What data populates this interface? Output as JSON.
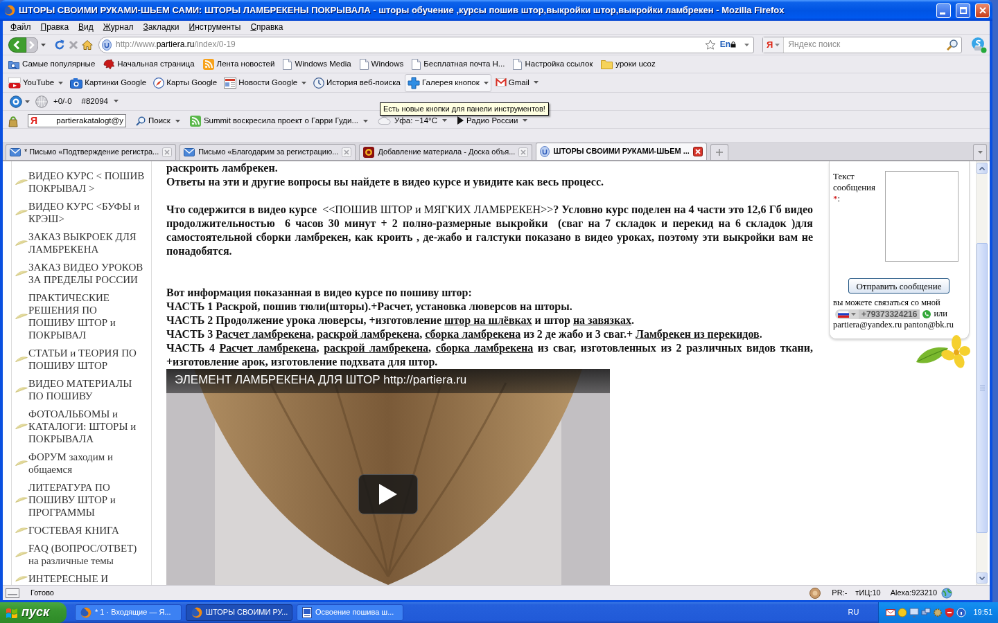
{
  "window": {
    "title": "ШТОРЫ СВОИМИ РУКАМИ-ШЬЕМ САМИ: ШТОРЫ ЛАМБРЕКЕНЫ ПОКРЫВАЛА - шторы обучение ,курсы пошив штор,выкройки штор,выкройки ламбрекен - Mozilla Firefox"
  },
  "menu": [
    "Файл",
    "Правка",
    "Вид",
    "Журнал",
    "Закладки",
    "Инструменты",
    "Справка"
  ],
  "navigation": {
    "address": [
      {
        "text": "http://www.",
        "strong": false
      },
      {
        "text": "partiera.ru",
        "strong": true
      },
      {
        "text": "/index/0-19",
        "strong": false
      }
    ],
    "language": "En",
    "search_engine": "Я",
    "search": {
      "placeholder": "Яндекс поиск"
    }
  },
  "bookmarks": [
    {
      "label": "Самые популярные",
      "kind": "query"
    },
    {
      "label": "Начальная страница",
      "kind": "homepage"
    },
    {
      "label": "Лента новостей",
      "kind": "livemark"
    },
    {
      "label": "Windows Media",
      "kind": "page"
    },
    {
      "label": "Windows",
      "kind": "page"
    },
    {
      "label": "Бесплатная почта Н...",
      "kind": "page"
    },
    {
      "label": "Настройка ссылок",
      "kind": "page"
    },
    {
      "label": "уроки ucoz",
      "kind": "folder"
    }
  ],
  "google_toolbar": [
    {
      "label": "YouTube",
      "kind": "video",
      "has_menu": true,
      "highlighted": false
    },
    {
      "label": "Картинки Google",
      "kind": "images",
      "has_menu": false,
      "highlighted": false
    },
    {
      "label": "Карты Google",
      "kind": "maps",
      "has_menu": false,
      "highlighted": false
    },
    {
      "label": "Новости Google",
      "kind": "news",
      "has_menu": true,
      "highlighted": false
    },
    {
      "label": "История веб-поиска",
      "kind": "history",
      "has_menu": false,
      "highlighted": false
    },
    {
      "label": "Галерея кнопок",
      "kind": "gallery",
      "has_menu": true,
      "highlighted": true
    },
    {
      "label": "Gmail",
      "kind": "mail",
      "has_menu": true,
      "highlighted": false
    }
  ],
  "counter_toolbar": {
    "score": "+0/-0",
    "counter": "#82094"
  },
  "tooltip": {
    "text": "Есть новые кнопки для панели инструментов!"
  },
  "yandex_toolbar": {
    "logo_letter": "Я",
    "login": "partierakatalogt@y",
    "search": "Поиск",
    "news": "Summit воскресила проект о Гарри Гуди...",
    "weather": "Уфа: −14°C",
    "radio": "Радио России"
  },
  "tabs": [
    {
      "label": "* Письмо «Подтверждение регистра...",
      "kind": "mail",
      "selected": false
    },
    {
      "label": "Письмо «Благодарим за регистрацию...",
      "kind": "mail",
      "selected": false
    },
    {
      "label": "Добавление материала - Доска объя...",
      "kind": "board",
      "selected": false
    },
    {
      "label": "ШТОРЫ СВОИМИ РУКАМИ-ШЬЕМ ...",
      "kind": "site",
      "selected": true
    }
  ],
  "sidebar": {
    "items": [
      "ВИДЕО КУРС < ПОШИВ ПОКРЫВАЛ >",
      "ВИДЕО КУРС <БУФЫ и КРЭШ>",
      "ЗАКАЗ ВЫКРОЕК ДЛЯ ЛАМБРЕКЕНА",
      "ЗАКАЗ ВИДЕО УРОКОВ ЗА ПРЕДЕЛЫ РОССИИ",
      "ПРАКТИЧЕСКИЕ РЕШЕНИЯ ПО ПОШИВУ ШТОР и ПОКРЫВАЛ",
      "СТАТЬИ и ТЕОРИЯ ПО ПОШИВУ ШТОР",
      "ВИДЕО МАТЕРИАЛЫ ПО ПОШИВУ",
      "ФОТОАЛЬБОМЫ и КАТАЛОГИ: ШТОРЫ и ПОКРЫВАЛА",
      "ФОРУМ заходим и общаемся",
      "ЛИТЕРАТУРА ПО ПОШИВУ ШТОР и ПРОГРАММЫ",
      "ГОСТЕВАЯ КНИГА",
      "FAQ (ВОПРОС/ОТВЕТ) на различные темы",
      "ИНТЕРЕСНЫЕ И"
    ]
  },
  "article": {
    "intro": [
      "раскроить ламбрекен.",
      "Ответы на эти и другие вопросы вы найдете в видео курсе и увидите как весь процесс."
    ],
    "summary": "**Что содержится в видео курсе**  <<ПОШИВ ШТОР и МЯГКИХ ЛАМБРЕКЕН>>**? Условно курс поделен на 4 части это 12,6 Гб видео продолжительностью  6 часов 30 минут + 2 полно-размерные выкройки  (сваг на 7 складок и перекид на 6 складок )для самостоятельной сборки ламбрекен, как кроить , де-жабо и галстуки показано в видео уроках, поэтому эти выкройки вам не понадобятся.**",
    "parts_heading": "Вот информация показанная в видео курсе по пошиву штор:",
    "parts": [
      {
        "segments": [
          {
            "text": "ЧАСТЬ 1 Раскрой, пошив тюли(шторы).+Расчет, установка люверсов на шторы.",
            "link": false
          }
        ]
      },
      {
        "segments": [
          {
            "text": "ЧАСТЬ 2 Продолжение урока люверсы, +изготовление ",
            "link": false
          },
          {
            "text": "штор на шлёвках",
            "link": true
          },
          {
            "text": " и штор ",
            "link": false
          },
          {
            "text": "на завязках",
            "link": true
          },
          {
            "text": ".",
            "link": false
          }
        ]
      },
      {
        "segments": [
          {
            "text": "ЧАСТЬ 3 ",
            "link": false
          },
          {
            "text": "Расчет ламбрекена",
            "link": true
          },
          {
            "text": ", ",
            "link": false
          },
          {
            "text": "раскрой ламбрекена",
            "link": true
          },
          {
            "text": ", ",
            "link": false
          },
          {
            "text": "сборка ламбрекена",
            "link": true
          },
          {
            "text": " из 2 де жабо и 3 сваг.+ ",
            "link": false
          },
          {
            "text": "Ламбрекен из перекидов",
            "link": true
          },
          {
            "text": ".",
            "link": false
          }
        ]
      },
      {
        "segments": [
          {
            "text": "ЧАСТЬ 4 ",
            "link": false
          },
          {
            "text": "Расчет ламбрекена",
            "link": true
          },
          {
            "text": ", ",
            "link": false
          },
          {
            "text": "раскрой ламбрекена",
            "link": true
          },
          {
            "text": ", ",
            "link": false
          },
          {
            "text": "сборка ламбрекена",
            "link": true
          },
          {
            "text": " из сваг, изготовленных из 2 различных видов ткани, +изготовление арок, изготовление подхвата для штор.",
            "link": false
          }
        ]
      }
    ],
    "video": {
      "title": "ЭЛЕМЕНТ ЛАМБРЕКЕНА ДЛЯ ШТОР http://partiera.ru"
    }
  },
  "contact": {
    "message_label": "Текст сообщения",
    "required_mark": "*",
    "label_end": ":",
    "send_button": "Отправить сообщение",
    "note": "вы можете связаться со мной",
    "phone": "+79373324216",
    "or": "или",
    "emails": "partiera@yandex.ru panton@bk.ru"
  },
  "status_bar": {
    "text": "Готово",
    "pr": "PR:-",
    "tic": "тИЦ:10",
    "alexa": "Alexa:923210"
  },
  "taskbar": {
    "start": "пуск",
    "tasks": [
      {
        "label": "* 1 · Входящие — Я...",
        "kind": "browser",
        "selected": false
      },
      {
        "label": "ШТОРЫ СВОИМИ РУ...",
        "kind": "browser",
        "selected": true
      },
      {
        "label": "Освоение пошива ш...",
        "kind": "document",
        "selected": false
      }
    ],
    "language": "RU",
    "clock": "19:51"
  }
}
